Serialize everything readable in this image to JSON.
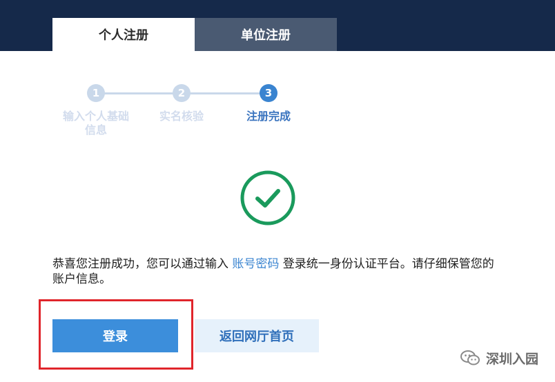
{
  "header": {
    "tabs": [
      {
        "label": "个人注册",
        "active": true
      },
      {
        "label": "单位注册",
        "active": false
      }
    ]
  },
  "steps": [
    {
      "number": "1",
      "label_line1": "输入个人基础",
      "label_line2": "信息",
      "state": "done"
    },
    {
      "number": "2",
      "label_line1": "实名核验",
      "label_line2": "",
      "state": "done"
    },
    {
      "number": "3",
      "label_line1": "注册完成",
      "label_line2": "",
      "state": "active"
    }
  ],
  "success_icon": "check-circle-icon",
  "message": {
    "before": "恭喜您注册成功，您可以通过输入 ",
    "link": "账号密码",
    "after": " 登录统一身份认证平台。请仔细保管您的账户信息。"
  },
  "buttons": {
    "login": "登录",
    "back_home": "返回网厅首页"
  },
  "watermark": {
    "icon": "wechat-icon",
    "text": "深圳入园"
  },
  "colors": {
    "header_bg": "#15294a",
    "primary": "#3c8edb",
    "success": "#1a9a5c",
    "highlight_frame": "#e0252b"
  }
}
